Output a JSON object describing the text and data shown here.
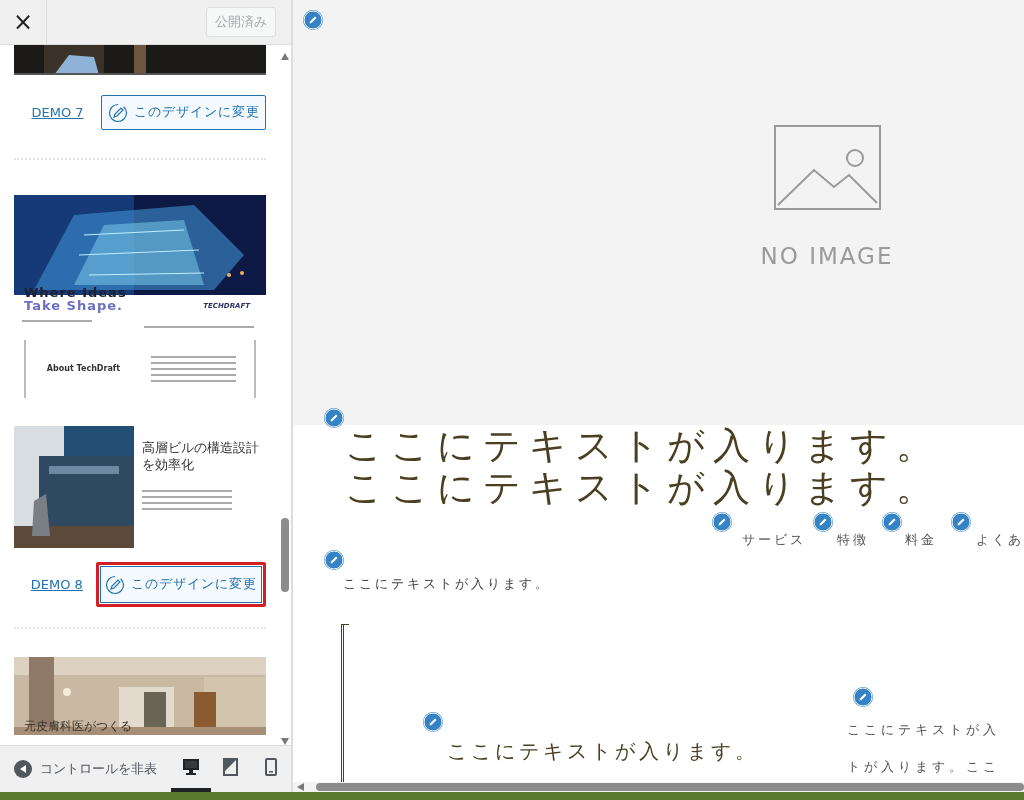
{
  "header": {
    "close": "×",
    "publish_button": "公開済み"
  },
  "demos": [
    {
      "kind": "cut",
      "label": "DEMO 7",
      "button": "このデザインに変更",
      "highlighted": false
    },
    {
      "kind": "techdraft",
      "label": "DEMO 8",
      "button": "このデザインに変更",
      "highlighted": true,
      "hero_line_1": "Where Ideas",
      "hero_line_2": "Take Shape.",
      "brand": "TECHDRAFT",
      "about": "About TechDraft",
      "section_title": "高層ビルの構造設計を効率化"
    },
    {
      "kind": "clinic",
      "caption": "元皮膚科医がつくる"
    }
  ],
  "footer": {
    "hide_controls": "コントロールを非表",
    "devices": [
      {
        "kind": "desktop",
        "selected": true
      },
      {
        "kind": "tablet",
        "selected": false
      },
      {
        "kind": "mobile",
        "selected": false
      }
    ]
  },
  "preview": {
    "placeholder": "NO IMAGE",
    "heading": [
      "ここにテキストが入ります。",
      "ここにテキストが入ります。"
    ],
    "nav": [
      "サービス",
      "特徴",
      "料金",
      "よくあ"
    ],
    "lead": "ここにテキストが入ります。",
    "subheading": "ここにテキストが入ります。",
    "side_text": [
      "ここにテキストが入",
      "トが入ります。ここ"
    ]
  }
}
